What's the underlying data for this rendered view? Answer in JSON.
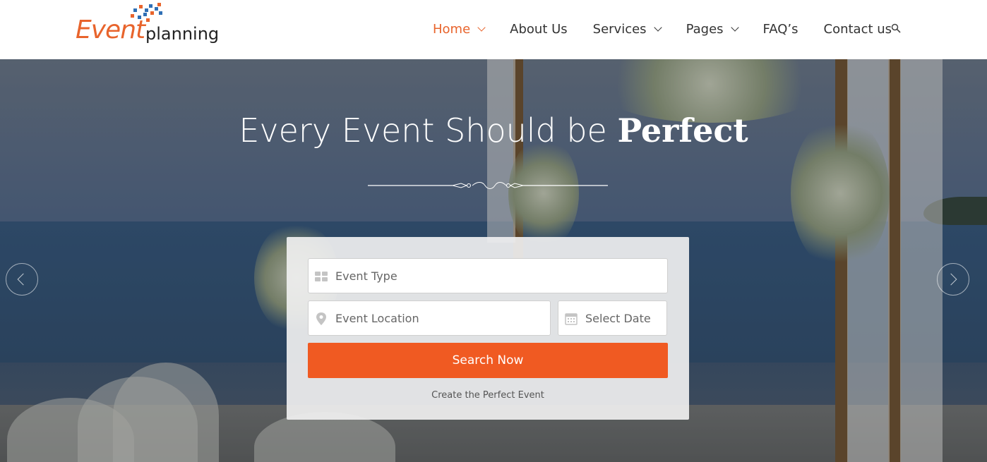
{
  "brand": {
    "logo_part1": "Event",
    "logo_part2": "planning",
    "accent_color": "#e8642c",
    "button_color": "#f05a22"
  },
  "nav": {
    "items": [
      {
        "label": "Home",
        "active": true,
        "has_dropdown": true
      },
      {
        "label": "About Us",
        "active": false,
        "has_dropdown": false
      },
      {
        "label": "Services",
        "active": false,
        "has_dropdown": true
      },
      {
        "label": "Pages",
        "active": false,
        "has_dropdown": true
      },
      {
        "label": "FAQ’s",
        "active": false,
        "has_dropdown": false
      },
      {
        "label": "Contact us",
        "active": false,
        "has_dropdown": false
      }
    ],
    "search_icon": "search-icon"
  },
  "hero": {
    "title_light": "Every Event Should be ",
    "title_bold": "Perfect",
    "prev_icon": "chevron-left-icon",
    "next_icon": "chevron-right-icon"
  },
  "search_form": {
    "event_type_placeholder": "Event Type",
    "event_type_icon": "grid-icon",
    "location_placeholder": "Event Location",
    "location_icon": "map-pin-icon",
    "date_placeholder": "Select Date",
    "date_icon": "calendar-icon",
    "submit_label": "Search Now",
    "tagline": "Create the Perfect Event"
  }
}
